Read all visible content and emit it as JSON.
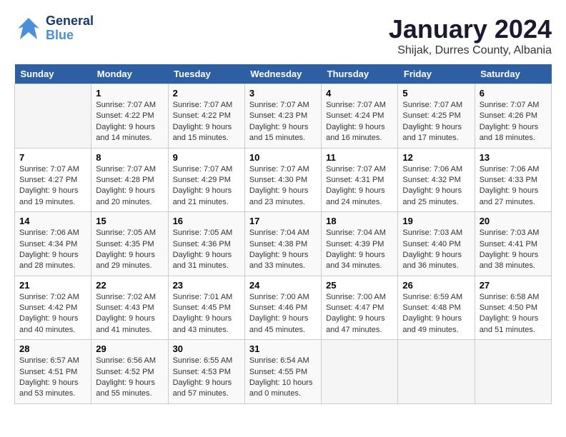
{
  "header": {
    "logo_line1": "General",
    "logo_line2": "Blue",
    "title": "January 2024",
    "subtitle": "Shijak, Durres County, Albania"
  },
  "calendar": {
    "days_of_week": [
      "Sunday",
      "Monday",
      "Tuesday",
      "Wednesday",
      "Thursday",
      "Friday",
      "Saturday"
    ],
    "weeks": [
      [
        {
          "day": "",
          "detail": ""
        },
        {
          "day": "1",
          "detail": "Sunrise: 7:07 AM\nSunset: 4:22 PM\nDaylight: 9 hours\nand 14 minutes."
        },
        {
          "day": "2",
          "detail": "Sunrise: 7:07 AM\nSunset: 4:22 PM\nDaylight: 9 hours\nand 15 minutes."
        },
        {
          "day": "3",
          "detail": "Sunrise: 7:07 AM\nSunset: 4:23 PM\nDaylight: 9 hours\nand 15 minutes."
        },
        {
          "day": "4",
          "detail": "Sunrise: 7:07 AM\nSunset: 4:24 PM\nDaylight: 9 hours\nand 16 minutes."
        },
        {
          "day": "5",
          "detail": "Sunrise: 7:07 AM\nSunset: 4:25 PM\nDaylight: 9 hours\nand 17 minutes."
        },
        {
          "day": "6",
          "detail": "Sunrise: 7:07 AM\nSunset: 4:26 PM\nDaylight: 9 hours\nand 18 minutes."
        }
      ],
      [
        {
          "day": "7",
          "detail": "Sunrise: 7:07 AM\nSunset: 4:27 PM\nDaylight: 9 hours\nand 19 minutes."
        },
        {
          "day": "8",
          "detail": "Sunrise: 7:07 AM\nSunset: 4:28 PM\nDaylight: 9 hours\nand 20 minutes."
        },
        {
          "day": "9",
          "detail": "Sunrise: 7:07 AM\nSunset: 4:29 PM\nDaylight: 9 hours\nand 21 minutes."
        },
        {
          "day": "10",
          "detail": "Sunrise: 7:07 AM\nSunset: 4:30 PM\nDaylight: 9 hours\nand 23 minutes."
        },
        {
          "day": "11",
          "detail": "Sunrise: 7:07 AM\nSunset: 4:31 PM\nDaylight: 9 hours\nand 24 minutes."
        },
        {
          "day": "12",
          "detail": "Sunrise: 7:06 AM\nSunset: 4:32 PM\nDaylight: 9 hours\nand 25 minutes."
        },
        {
          "day": "13",
          "detail": "Sunrise: 7:06 AM\nSunset: 4:33 PM\nDaylight: 9 hours\nand 27 minutes."
        }
      ],
      [
        {
          "day": "14",
          "detail": "Sunrise: 7:06 AM\nSunset: 4:34 PM\nDaylight: 9 hours\nand 28 minutes."
        },
        {
          "day": "15",
          "detail": "Sunrise: 7:05 AM\nSunset: 4:35 PM\nDaylight: 9 hours\nand 29 minutes."
        },
        {
          "day": "16",
          "detail": "Sunrise: 7:05 AM\nSunset: 4:36 PM\nDaylight: 9 hours\nand 31 minutes."
        },
        {
          "day": "17",
          "detail": "Sunrise: 7:04 AM\nSunset: 4:38 PM\nDaylight: 9 hours\nand 33 minutes."
        },
        {
          "day": "18",
          "detail": "Sunrise: 7:04 AM\nSunset: 4:39 PM\nDaylight: 9 hours\nand 34 minutes."
        },
        {
          "day": "19",
          "detail": "Sunrise: 7:03 AM\nSunset: 4:40 PM\nDaylight: 9 hours\nand 36 minutes."
        },
        {
          "day": "20",
          "detail": "Sunrise: 7:03 AM\nSunset: 4:41 PM\nDaylight: 9 hours\nand 38 minutes."
        }
      ],
      [
        {
          "day": "21",
          "detail": "Sunrise: 7:02 AM\nSunset: 4:42 PM\nDaylight: 9 hours\nand 40 minutes."
        },
        {
          "day": "22",
          "detail": "Sunrise: 7:02 AM\nSunset: 4:43 PM\nDaylight: 9 hours\nand 41 minutes."
        },
        {
          "day": "23",
          "detail": "Sunrise: 7:01 AM\nSunset: 4:45 PM\nDaylight: 9 hours\nand 43 minutes."
        },
        {
          "day": "24",
          "detail": "Sunrise: 7:00 AM\nSunset: 4:46 PM\nDaylight: 9 hours\nand 45 minutes."
        },
        {
          "day": "25",
          "detail": "Sunrise: 7:00 AM\nSunset: 4:47 PM\nDaylight: 9 hours\nand 47 minutes."
        },
        {
          "day": "26",
          "detail": "Sunrise: 6:59 AM\nSunset: 4:48 PM\nDaylight: 9 hours\nand 49 minutes."
        },
        {
          "day": "27",
          "detail": "Sunrise: 6:58 AM\nSunset: 4:50 PM\nDaylight: 9 hours\nand 51 minutes."
        }
      ],
      [
        {
          "day": "28",
          "detail": "Sunrise: 6:57 AM\nSunset: 4:51 PM\nDaylight: 9 hours\nand 53 minutes."
        },
        {
          "day": "29",
          "detail": "Sunrise: 6:56 AM\nSunset: 4:52 PM\nDaylight: 9 hours\nand 55 minutes."
        },
        {
          "day": "30",
          "detail": "Sunrise: 6:55 AM\nSunset: 4:53 PM\nDaylight: 9 hours\nand 57 minutes."
        },
        {
          "day": "31",
          "detail": "Sunrise: 6:54 AM\nSunset: 4:55 PM\nDaylight: 10 hours\nand 0 minutes."
        },
        {
          "day": "",
          "detail": ""
        },
        {
          "day": "",
          "detail": ""
        },
        {
          "day": "",
          "detail": ""
        }
      ]
    ]
  }
}
